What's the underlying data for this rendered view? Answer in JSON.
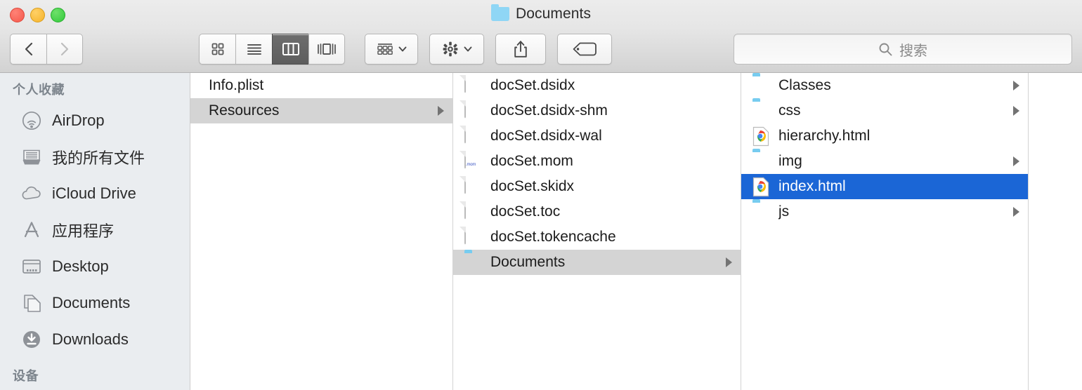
{
  "window": {
    "title": "Documents",
    "title_icon": "folder-icon",
    "traffic_lights": [
      {
        "name": "close-button",
        "color": "#f4594c"
      },
      {
        "name": "minimize-button",
        "color": "#f5b32a"
      },
      {
        "name": "maximize-button",
        "color": "#33c93b"
      }
    ]
  },
  "toolbar": {
    "back_label": "back-icon",
    "forward_label": "forward-icon",
    "view_modes": [
      {
        "name": "icon-view",
        "icon": "grid-icon",
        "active": false
      },
      {
        "name": "list-view",
        "icon": "list-icon",
        "active": false
      },
      {
        "name": "column-view",
        "icon": "columns-icon",
        "active": true
      },
      {
        "name": "coverflow-view",
        "icon": "coverflow-icon",
        "active": false
      }
    ],
    "arrange": {
      "name": "arrange-button",
      "icon": "arrange-icon"
    },
    "action": {
      "name": "action-button",
      "icon": "gear-icon"
    },
    "share": {
      "name": "share-button",
      "icon": "share-icon"
    },
    "tags": {
      "name": "tags-button",
      "icon": "tag-icon"
    }
  },
  "search": {
    "icon": "search-icon",
    "placeholder": "搜索",
    "value": ""
  },
  "sidebar": {
    "sections": [
      {
        "header": "个人收藏",
        "items": [
          {
            "label": "AirDrop",
            "icon": "airdrop-icon"
          },
          {
            "label": "我的所有文件",
            "icon": "all-my-files-icon"
          },
          {
            "label": "iCloud Drive",
            "icon": "icloud-icon"
          },
          {
            "label": "应用程序",
            "icon": "applications-icon"
          },
          {
            "label": "Desktop",
            "icon": "desktop-icon"
          },
          {
            "label": "Documents",
            "icon": "documents-icon"
          },
          {
            "label": "Downloads",
            "icon": "downloads-icon"
          }
        ]
      },
      {
        "header": "设备",
        "items": []
      }
    ]
  },
  "columns": [
    {
      "name": "column-1",
      "rows": [
        {
          "label": "Info.plist",
          "icon": "plist-file-icon",
          "selected": "none",
          "has_children": false
        },
        {
          "label": "Resources",
          "icon": "blue-clip-icon",
          "selected": "gray",
          "has_children": true
        }
      ]
    },
    {
      "name": "column-2",
      "rows": [
        {
          "label": "docSet.dsidx",
          "icon": "document-icon",
          "selected": "none",
          "has_children": false
        },
        {
          "label": "docSet.dsidx-shm",
          "icon": "document-icon",
          "selected": "none",
          "has_children": false
        },
        {
          "label": "docSet.dsidx-wal",
          "icon": "document-icon",
          "selected": "none",
          "has_children": false
        },
        {
          "label": "docSet.mom",
          "icon": "mom-document-icon",
          "selected": "none",
          "has_children": false,
          "ext_badge": ".mom"
        },
        {
          "label": "docSet.skidx",
          "icon": "document-icon",
          "selected": "none",
          "has_children": false
        },
        {
          "label": "docSet.toc",
          "icon": "document-icon",
          "selected": "none",
          "has_children": false
        },
        {
          "label": "docSet.tokencache",
          "icon": "document-icon",
          "selected": "none",
          "has_children": false
        },
        {
          "label": "Documents",
          "icon": "folder-icon",
          "selected": "gray",
          "has_children": true
        }
      ]
    },
    {
      "name": "column-3",
      "rows": [
        {
          "label": "Classes",
          "icon": "folder-icon",
          "selected": "none",
          "has_children": true
        },
        {
          "label": "css",
          "icon": "folder-icon",
          "selected": "none",
          "has_children": true
        },
        {
          "label": "hierarchy.html",
          "icon": "chrome-icon",
          "selected": "none",
          "has_children": false
        },
        {
          "label": "img",
          "icon": "folder-icon",
          "selected": "none",
          "has_children": true
        },
        {
          "label": "index.html",
          "icon": "chrome-icon",
          "selected": "blue",
          "has_children": false
        },
        {
          "label": "js",
          "icon": "folder-icon",
          "selected": "none",
          "has_children": true
        }
      ]
    },
    {
      "name": "column-4",
      "rows": []
    }
  ],
  "colors": {
    "selection_blue": "#1b66d6",
    "selection_gray": "#d4d4d4",
    "folder_blue": "#77ccf0",
    "sidebar_bg": "#eaedf0",
    "toolbar_top": "#ececec",
    "toolbar_bottom": "#d2d2d2"
  }
}
